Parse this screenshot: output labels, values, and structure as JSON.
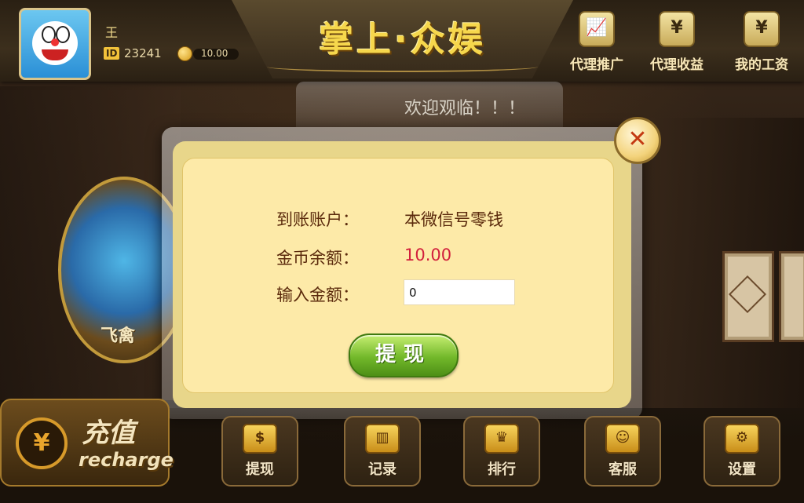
{
  "user": {
    "name": "王",
    "id_label": "ID",
    "id": "23241",
    "coins": "10.00"
  },
  "app_title": "掌上·众娱",
  "top_actions": [
    {
      "label": "代理推广",
      "icon": "chart-icon"
    },
    {
      "label": "代理收益",
      "icon": "money-bag-icon"
    },
    {
      "label": "我的工资",
      "icon": "receipt-icon"
    }
  ],
  "marquee": "欢迎观临！！！",
  "game": {
    "label": "飞禽"
  },
  "dialog": {
    "account_label": "到账账户：",
    "account_value": "本微信号零钱",
    "balance_label": "金币余额：",
    "balance_value": "10.00",
    "input_label": "输入金额：",
    "input_value": "0",
    "submit_label": "提现",
    "close_icon": "close-icon"
  },
  "recharge": {
    "title": "充值",
    "subtitle": "recharge",
    "icon": "yen-coin-icon"
  },
  "bottom_nav": [
    {
      "label": "提现",
      "icon": "withdraw-icon"
    },
    {
      "label": "记录",
      "icon": "record-icon"
    },
    {
      "label": "排行",
      "icon": "crown-icon"
    },
    {
      "label": "客服",
      "icon": "support-icon"
    },
    {
      "label": "设置",
      "icon": "gear-icon"
    }
  ],
  "colors": {
    "accent_gold": "#f6d74c",
    "balance_red": "#d21f3c",
    "button_green": "#72b82a",
    "dialog_bg": "#fdeaa8"
  }
}
